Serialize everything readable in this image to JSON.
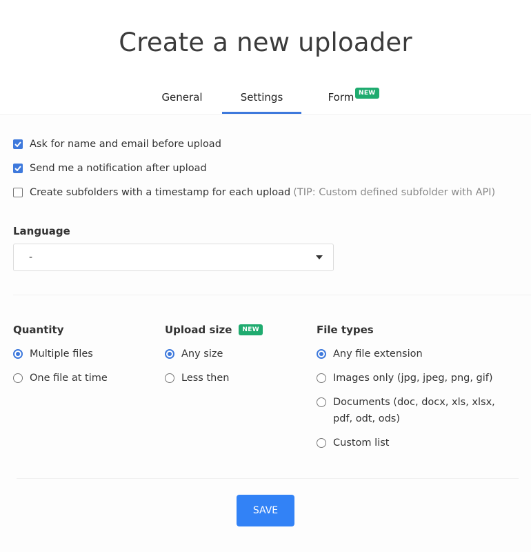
{
  "header": {
    "title": "Create a new uploader"
  },
  "tabs": [
    {
      "label": "General",
      "active": false
    },
    {
      "label": "Settings",
      "active": true
    },
    {
      "label": "Form",
      "active": false,
      "badge": "NEW"
    }
  ],
  "options": [
    {
      "label": "Ask for name and email before upload",
      "checked": true
    },
    {
      "label": "Send me a notification after upload",
      "checked": true
    },
    {
      "label": "Create subfolders with a timestamp for each upload",
      "checked": false,
      "tip": "(TIP: Custom defined subfolder with API)"
    }
  ],
  "language": {
    "label": "Language",
    "value": "-",
    "icon": "caret-down-icon"
  },
  "quantity": {
    "title": "Quantity",
    "options": [
      {
        "label": "Multiple files",
        "selected": true
      },
      {
        "label": "One file at time",
        "selected": false
      }
    ]
  },
  "upload_size": {
    "title": "Upload size",
    "badge": "NEW",
    "options": [
      {
        "label": "Any size",
        "selected": true
      },
      {
        "label": "Less then",
        "selected": false
      }
    ]
  },
  "file_types": {
    "title": "File types",
    "options": [
      {
        "label": "Any file extension",
        "selected": true
      },
      {
        "label": "Images only (jpg, jpeg, png, gif)",
        "selected": false
      },
      {
        "label": "Documents (doc, docx, xls, xlsx, pdf, odt, ods)",
        "selected": false
      },
      {
        "label": "Custom list",
        "selected": false
      }
    ]
  },
  "actions": {
    "save_label": "SAVE"
  },
  "colors": {
    "accent": "#3e79dc",
    "button": "#3282f6",
    "badge": "#1fab6f"
  }
}
